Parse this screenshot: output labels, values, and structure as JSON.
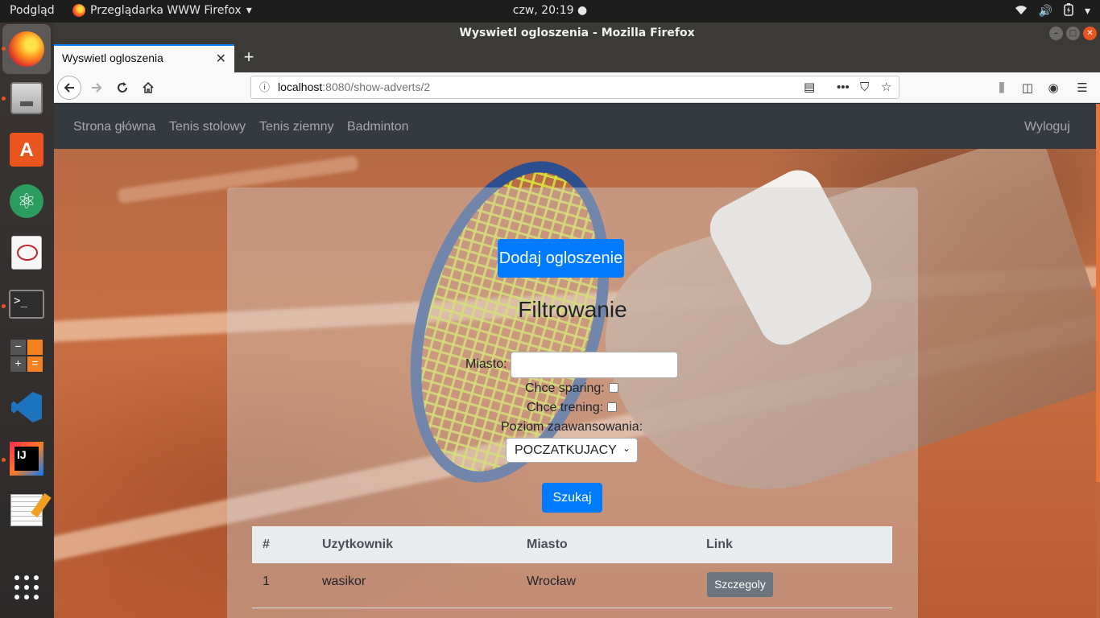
{
  "topbar": {
    "activities": "Podgląd",
    "app_menu": "Przeglądarka WWW Firefox",
    "clock": "czw, 20:19"
  },
  "window": {
    "title": "Wyswietl ogloszenia - Mozilla Firefox",
    "tab_title": "Wyswietl ogloszenia"
  },
  "urlbar": {
    "host": "localhost",
    "rest": ":8080/show-adverts/2"
  },
  "site_nav": {
    "links": [
      "Strona główna",
      "Tenis stolowy",
      "Tenis ziemny",
      "Badminton"
    ],
    "logout": "Wyloguj"
  },
  "page": {
    "add_button": "Dodaj ogloszenie",
    "filter_title": "Filtrowanie",
    "city_label": "Miasto:",
    "sparring_label": "Chce sparing:",
    "training_label": "Chce trening:",
    "level_label": "Poziom zaawansowania:",
    "level_value": "POCZATKUJACY",
    "search_button": "Szukaj"
  },
  "table": {
    "headers": [
      "#",
      "Uzytkownik",
      "Miasto",
      "Link"
    ],
    "rows": [
      {
        "num": "1",
        "user": "wasikor",
        "city": "Wrocław",
        "link": "Szczegoly"
      }
    ]
  },
  "colors": {
    "primary": "#007bff",
    "secondary": "#6c757d",
    "navbar": "#343a40",
    "ubuntu_accent": "#e9541f"
  }
}
